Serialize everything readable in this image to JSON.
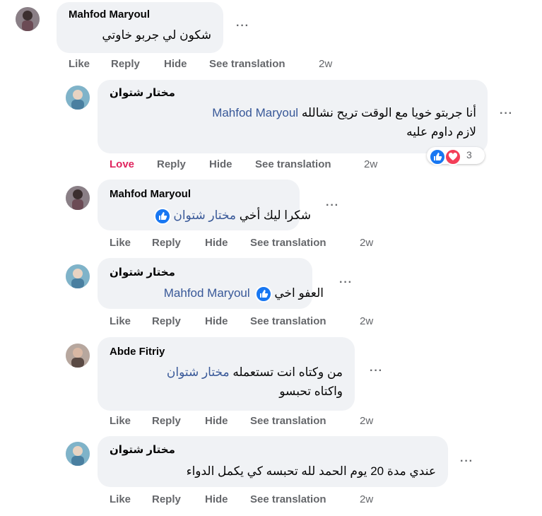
{
  "actions": {
    "like": "Like",
    "love": "Love",
    "reply": "Reply",
    "hide": "Hide",
    "see_translation": "See translation",
    "more": "···"
  },
  "colors": {
    "bubble": "#f0f2f5",
    "mention": "#385898",
    "action_gray": "#65676b",
    "love_red": "#e0245e",
    "like_blue": "#1877f2"
  },
  "comments": [
    {
      "author": "Mahfod Maryoul",
      "lines": [
        "شكون لي جربو خاوتي"
      ],
      "time": "2w",
      "first_action": "Like"
    },
    {
      "author": "مختار شتوان",
      "mention": "Mahfod Maryoul",
      "line1_text": "أنا جربتو خويا مع الوقت تريح نشالله",
      "line2_text": "لازم داوم عليه",
      "reaction_icons": [
        "like-icon",
        "love-icon"
      ],
      "reaction_count": "3",
      "time": "2w",
      "first_action": "Love"
    },
    {
      "author": "Mahfod Maryoul",
      "mention": "مختار شتوان",
      "body_text": "شكرا ليك أخي",
      "time": "2w",
      "first_action": "Like"
    },
    {
      "author": "مختار شتوان",
      "mention": "Mahfod Maryoul",
      "body_text": "العفو اخي",
      "time": "2w",
      "first_action": "Like"
    },
    {
      "author": "Abde Fitriy",
      "mention": "مختار شتوان",
      "line1_text": "من وكتاه انت تستعمله",
      "line2_text": "واكتاه تحبسو",
      "time": "2w",
      "first_action": "Like"
    },
    {
      "author": "مختار شتوان",
      "lines": [
        "عندي مدة 20 يوم الحمد لله تحبسه كي يكمل الدواء"
      ],
      "time": "2w",
      "first_action": "Like"
    }
  ]
}
